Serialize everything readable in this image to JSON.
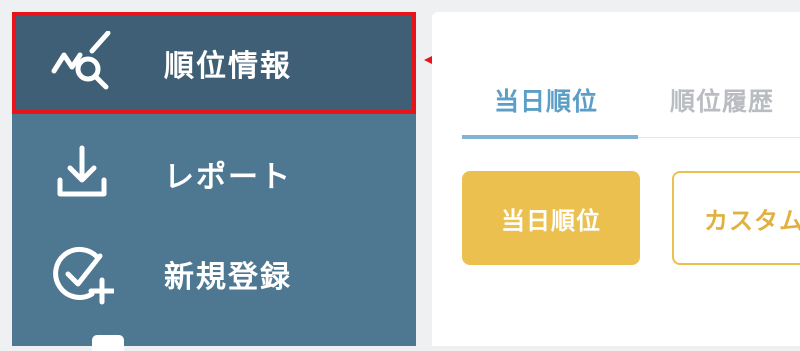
{
  "sidebar": {
    "items": [
      {
        "label": "順位情報",
        "icon": "ranking-search-icon",
        "active": true
      },
      {
        "label": "レポート",
        "icon": "download-icon",
        "active": false
      },
      {
        "label": "新規登録",
        "icon": "check-add-icon",
        "active": false
      }
    ]
  },
  "main": {
    "tabs": [
      {
        "label": "当日順位",
        "active": true
      },
      {
        "label": "順位履歴",
        "active": false
      }
    ],
    "buttons": {
      "today_label": "当日順位",
      "custom_label": "カスタム"
    }
  },
  "colors": {
    "sidebar": "#4e7891",
    "sidebar_active": "#3f5f76",
    "highlight": "#e8141b",
    "accent_blue": "#5b9ec6",
    "accent_yellow": "#ecc04f"
  }
}
